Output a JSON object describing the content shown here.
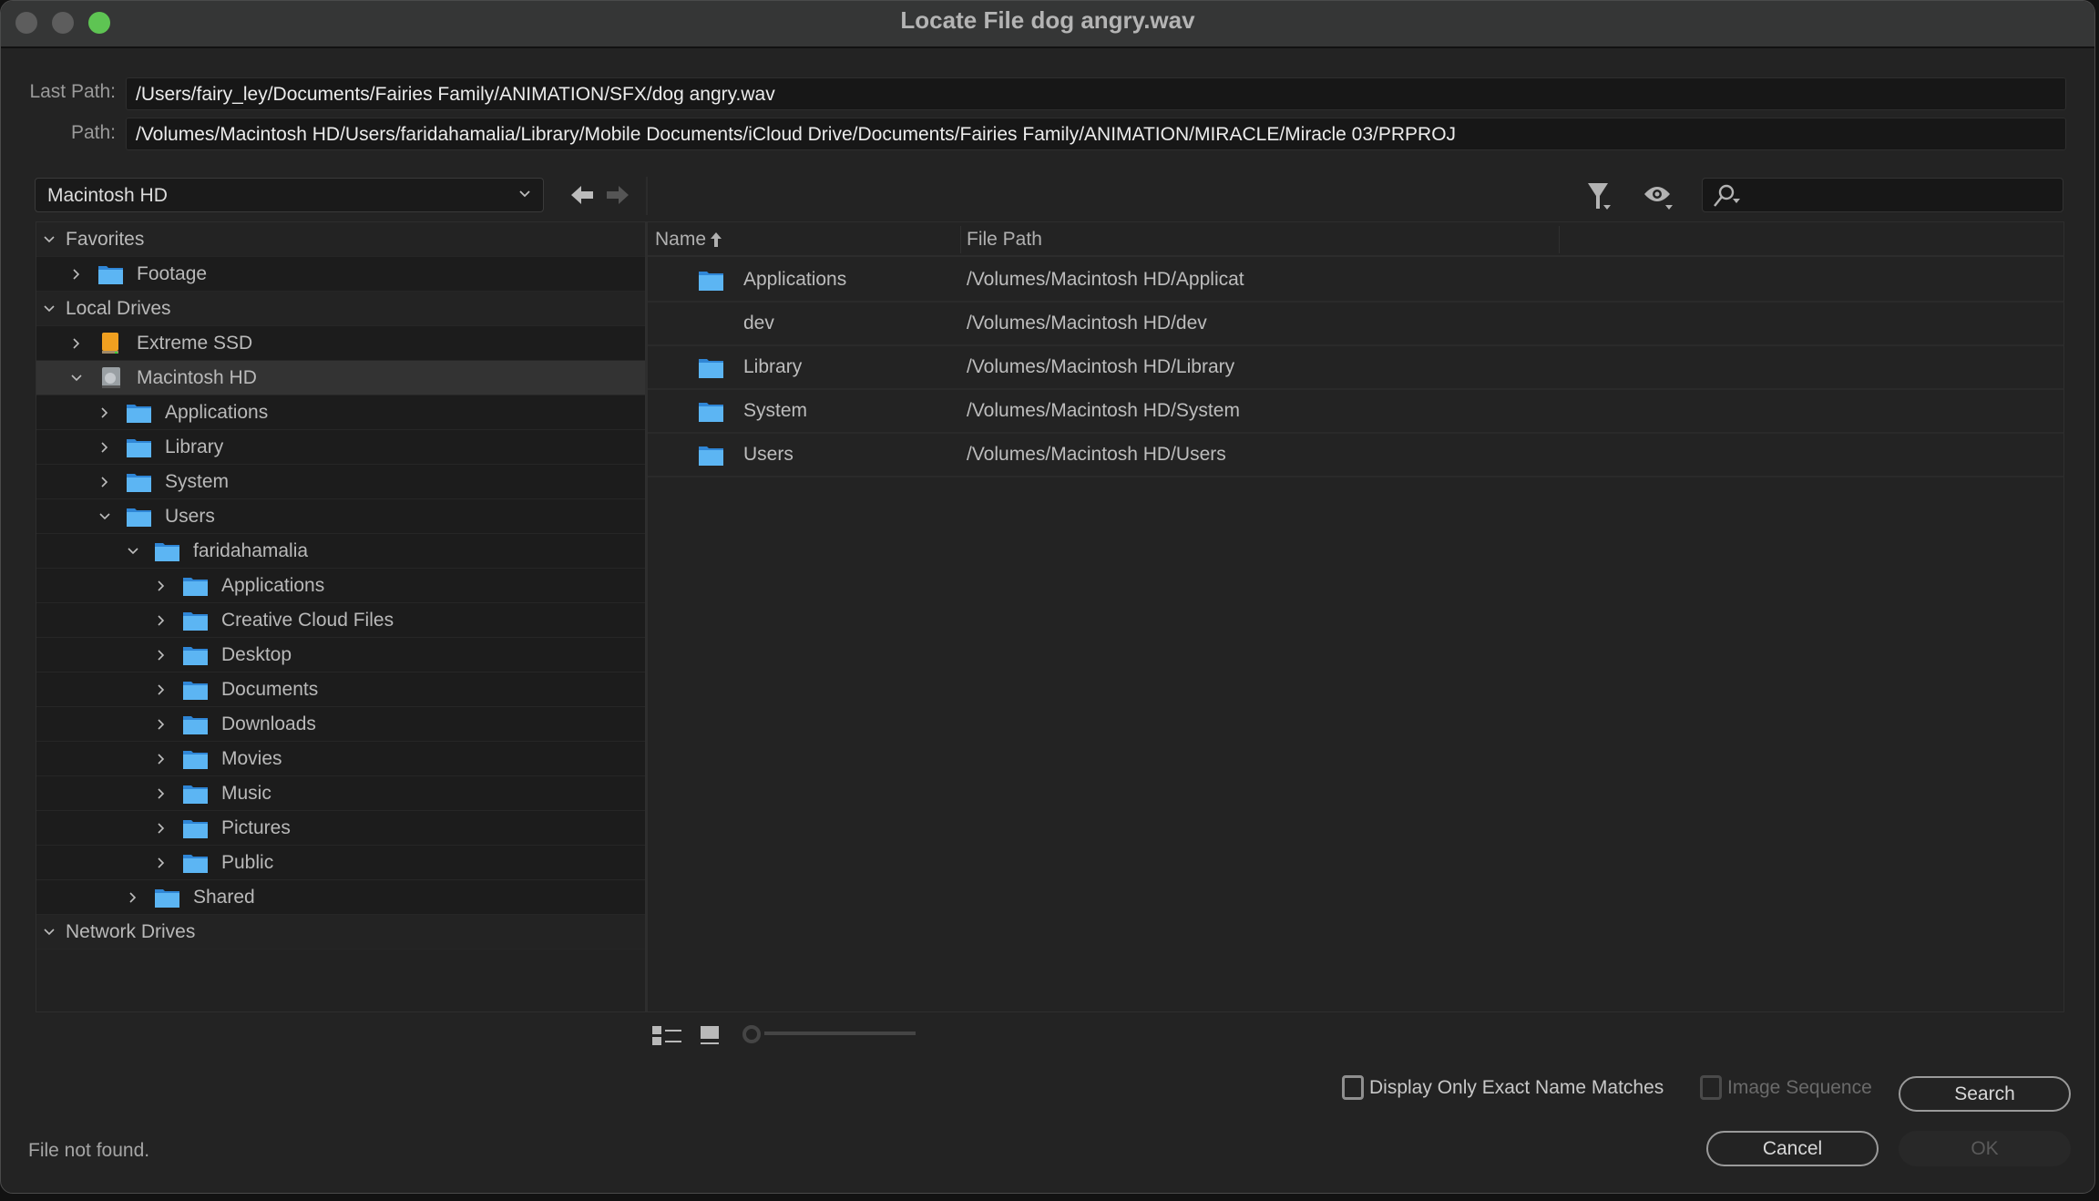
{
  "window": {
    "title": "Locate File dog angry.wav"
  },
  "paths": {
    "last_path_label": "Last Path:",
    "last_path_value": "/Users/fairy_ley/Documents/Fairies Family/ANIMATION/SFX/dog angry.wav",
    "path_label": "Path:",
    "path_value": "/Volumes/Macintosh HD/Users/faridahamalia/Library/Mobile Documents/iCloud Drive/Documents/Fairies Family/ANIMATION/MIRACLE/Miracle 03/PRPROJ"
  },
  "toolbar": {
    "drive_selected": "Macintosh HD",
    "back_icon": "arrow-left-icon",
    "forward_icon": "arrow-right-icon",
    "filter_icon": "filter-icon",
    "view_icon": "eye-icon",
    "search_icon": "search-icon",
    "search_placeholder": ""
  },
  "tree": {
    "rows": [
      {
        "label": "Favorites",
        "level": 0,
        "expanded": true,
        "type": "group",
        "icon": null
      },
      {
        "label": "Footage",
        "level": 1,
        "expanded": false,
        "type": "folder",
        "icon": "folder-icon"
      },
      {
        "label": "Local Drives",
        "level": 0,
        "expanded": true,
        "type": "group",
        "icon": null
      },
      {
        "label": "Extreme SSD",
        "level": 1,
        "expanded": false,
        "type": "drive",
        "icon": "external-drive-icon"
      },
      {
        "label": "Macintosh HD",
        "level": 1,
        "expanded": true,
        "type": "drive",
        "icon": "hard-drive-icon",
        "selected": true
      },
      {
        "label": "Applications",
        "level": 2,
        "expanded": false,
        "type": "folder",
        "icon": "applications-folder-icon"
      },
      {
        "label": "Library",
        "level": 2,
        "expanded": false,
        "type": "folder",
        "icon": "library-folder-icon"
      },
      {
        "label": "System",
        "level": 2,
        "expanded": false,
        "type": "folder",
        "icon": "system-folder-icon"
      },
      {
        "label": "Users",
        "level": 2,
        "expanded": true,
        "type": "folder",
        "icon": "users-folder-icon"
      },
      {
        "label": "faridahamalia",
        "level": 3,
        "expanded": true,
        "type": "folder",
        "icon": "home-folder-icon"
      },
      {
        "label": "Applications",
        "level": 4,
        "expanded": false,
        "type": "folder",
        "icon": "applications-folder-icon"
      },
      {
        "label": "Creative Cloud Files",
        "level": 4,
        "expanded": false,
        "type": "folder",
        "icon": "creative-cloud-folder-icon"
      },
      {
        "label": "Desktop",
        "level": 4,
        "expanded": false,
        "type": "folder",
        "icon": "desktop-folder-icon"
      },
      {
        "label": "Documents",
        "level": 4,
        "expanded": false,
        "type": "folder",
        "icon": "documents-folder-icon"
      },
      {
        "label": "Downloads",
        "level": 4,
        "expanded": false,
        "type": "folder",
        "icon": "downloads-folder-icon"
      },
      {
        "label": "Movies",
        "level": 4,
        "expanded": false,
        "type": "folder",
        "icon": "movies-folder-icon"
      },
      {
        "label": "Music",
        "level": 4,
        "expanded": false,
        "type": "folder",
        "icon": "music-folder-icon"
      },
      {
        "label": "Pictures",
        "level": 4,
        "expanded": false,
        "type": "folder",
        "icon": "pictures-folder-icon"
      },
      {
        "label": "Public",
        "level": 4,
        "expanded": false,
        "type": "folder",
        "icon": "public-folder-icon"
      },
      {
        "label": "Shared",
        "level": 3,
        "expanded": false,
        "type": "folder",
        "icon": "folder-icon"
      },
      {
        "label": "Network Drives",
        "level": 0,
        "expanded": true,
        "type": "group",
        "icon": null
      }
    ]
  },
  "file_list": {
    "columns": [
      {
        "label": "Name",
        "sort": "ascending",
        "sort_icon": "sort-ascending-icon"
      },
      {
        "label": "File Path"
      }
    ],
    "rows": [
      {
        "name": "Applications",
        "path": "/Volumes/Macintosh HD/Applicat",
        "icon": "applications-folder-icon"
      },
      {
        "name": "dev",
        "path": "/Volumes/Macintosh HD/dev",
        "icon": null
      },
      {
        "name": "Library",
        "path": "/Volumes/Macintosh HD/Library",
        "icon": "library-folder-icon"
      },
      {
        "name": "System",
        "path": "/Volumes/Macintosh HD/System",
        "icon": "system-folder-icon"
      },
      {
        "name": "Users",
        "path": "/Volumes/Macintosh HD/Users",
        "icon": "users-folder-icon"
      }
    ]
  },
  "view_controls": {
    "list_view_icon": "list-view-icon",
    "thumbnail_view_icon": "thumbnail-view-icon",
    "zoom_slider_value": 0
  },
  "options": {
    "exact_match_label": "Display Only Exact Name Matches",
    "exact_match_checked": false,
    "image_sequence_label": "Image Sequence",
    "image_sequence_checked": false,
    "image_sequence_enabled": false
  },
  "buttons": {
    "search": "Search",
    "cancel": "Cancel",
    "ok": "OK",
    "ok_enabled": false
  },
  "status": {
    "message": "File not found."
  },
  "colors": {
    "background": "#232323",
    "titlebar": "#353636",
    "field_bg": "#171717",
    "folder_blue": "#4aa8ec",
    "ssd_orange": "#f0a020",
    "traffic_green": "#5ec453"
  }
}
